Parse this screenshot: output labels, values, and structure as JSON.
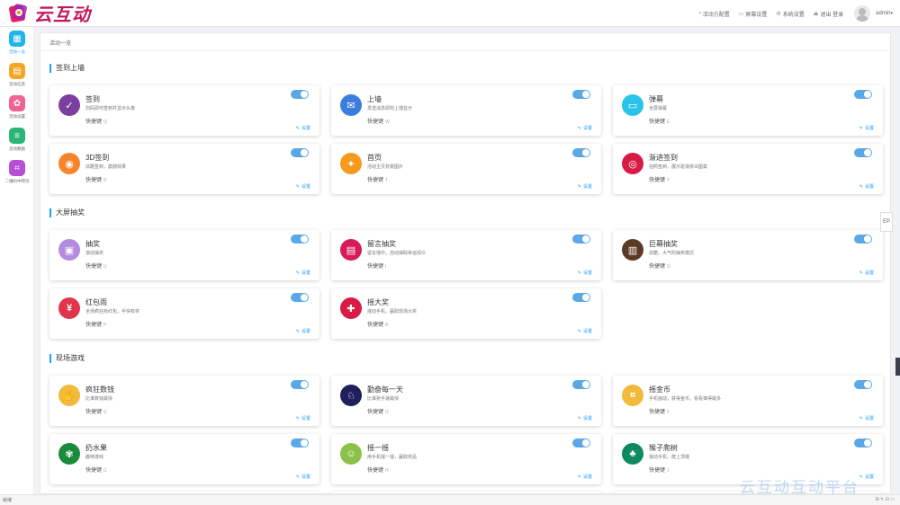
{
  "brand": {
    "name": "云互动"
  },
  "topnav": [
    {
      "icon": "doc-icon",
      "label": "活动方配置"
    },
    {
      "icon": "monitor-icon",
      "label": "屏幕设置"
    },
    {
      "icon": "settings-icon",
      "label": "系统设置"
    },
    {
      "icon": "logout-icon",
      "label": "退出 登录"
    }
  ],
  "user": {
    "name": "admin"
  },
  "sidebar": [
    {
      "label": "活动一览",
      "icon": "grid-icon",
      "color": "#1fb5e8",
      "glyph": "▦",
      "active": true
    },
    {
      "label": "活动信息",
      "icon": "document-icon",
      "color": "#f5a623",
      "glyph": "▤",
      "active": false
    },
    {
      "label": "活动设置",
      "icon": "gear-icon",
      "color": "#f06292",
      "glyph": "✿",
      "active": false
    },
    {
      "label": "活动数据",
      "icon": "database-icon",
      "color": "#2bb673",
      "glyph": "≡",
      "active": false
    },
    {
      "label": "二维码中转页",
      "icon": "qrcode-icon",
      "color": "#b44fd6",
      "glyph": "⌗",
      "active": false
    }
  ],
  "breadcrumb": "活动一览",
  "common": {
    "hotkey": "快捷键",
    "settings": "设置"
  },
  "sections": [
    {
      "title": "签到上墙",
      "items": [
        {
          "name": "签到",
          "desc": "扫码即可签到并显示头像",
          "key": "Q",
          "color": "#7b3fa0",
          "glyph": "✓",
          "icon": "checkmark-icon"
        },
        {
          "name": "上墙",
          "desc": "发送消息即刻上墙显示",
          "key": "W",
          "color": "#3b7ddd",
          "glyph": "✉",
          "icon": "message-icon"
        },
        {
          "name": "弹幕",
          "desc": "全屏弹幕",
          "key": "E",
          "color": "#29c3e8",
          "glyph": "▭",
          "icon": "danmu-icon"
        },
        {
          "name": "3D签到",
          "desc": "炫酷签到，震撼效果",
          "key": "R",
          "color": "#f5842a",
          "glyph": "◉",
          "icon": "globe-icon"
        },
        {
          "name": "首页",
          "desc": "活动主页背景图片",
          "key": "T",
          "color": "#f49a1d",
          "glyph": "✦",
          "icon": "curtain-icon"
        },
        {
          "name": "渐进签到",
          "desc": "拍照签到，展示逐渐拼出图案",
          "key": "Y",
          "color": "#d81b45",
          "glyph": "◎",
          "icon": "mosaic-icon"
        }
      ]
    },
    {
      "title": "大屏抽奖",
      "items": [
        {
          "name": "抽奖",
          "desc": "滚动抽奖",
          "key": "U",
          "color": "#b38be0",
          "glyph": "▣",
          "icon": "gift-icon"
        },
        {
          "name": "留言抽奖",
          "desc": "留言墙中，自动抽取幸运观众",
          "key": "I",
          "color": "#d81b5a",
          "glyph": "▤",
          "icon": "board-icon"
        },
        {
          "name": "巨幕抽奖",
          "desc": "炫酷，大气的抽奖模式",
          "key": "O",
          "color": "#5b3a26",
          "glyph": "▥",
          "icon": "screen-icon"
        },
        {
          "name": "红包雨",
          "desc": "全场疯狂抢红包，手快有奖",
          "key": "P",
          "color": "#e0354a",
          "glyph": "¥",
          "icon": "redpacket-icon"
        },
        {
          "name": "摇大奖",
          "desc": "摇动手机，赢取现场大奖",
          "key": "A",
          "color": "#d81b45",
          "glyph": "✚",
          "icon": "prize-icon"
        }
      ]
    },
    {
      "title": "现场游戏",
      "items": [
        {
          "name": "疯狂数钱",
          "desc": "比谁数钱最快",
          "key": "S",
          "color": "#f2b93b",
          "glyph": "✋",
          "icon": "hand-icon"
        },
        {
          "name": "勤奋每一天",
          "desc": "比谁抢手速最快",
          "key": "D",
          "color": "#1f1f5c",
          "glyph": "♘",
          "icon": "runner-icon"
        },
        {
          "name": "摇金币",
          "desc": "手机摇动，获得金币，看看谁得最多",
          "key": "F",
          "color": "#f2b93b",
          "glyph": "¤",
          "icon": "coin-icon"
        },
        {
          "name": "扔水果",
          "desc": "趣味游戏",
          "key": "G",
          "color": "#1a8a3d",
          "glyph": "✾",
          "icon": "fruit-icon"
        },
        {
          "name": "摇一摇",
          "desc": "用手机摇一摇，赢取奖品",
          "key": "H",
          "color": "#8bc34a",
          "glyph": "☺",
          "icon": "shake-icon"
        },
        {
          "name": "猴子爬树",
          "desc": "摇动手机，爬上顶端",
          "key": "J",
          "color": "#0f8a5f",
          "glyph": "♣",
          "icon": "tree-icon"
        }
      ]
    }
  ],
  "side_widget": "EP",
  "status": {
    "left": "就绪",
    "right": "⊞ ✎ ⊟ ▭"
  },
  "watermark": "云互动互动平台"
}
